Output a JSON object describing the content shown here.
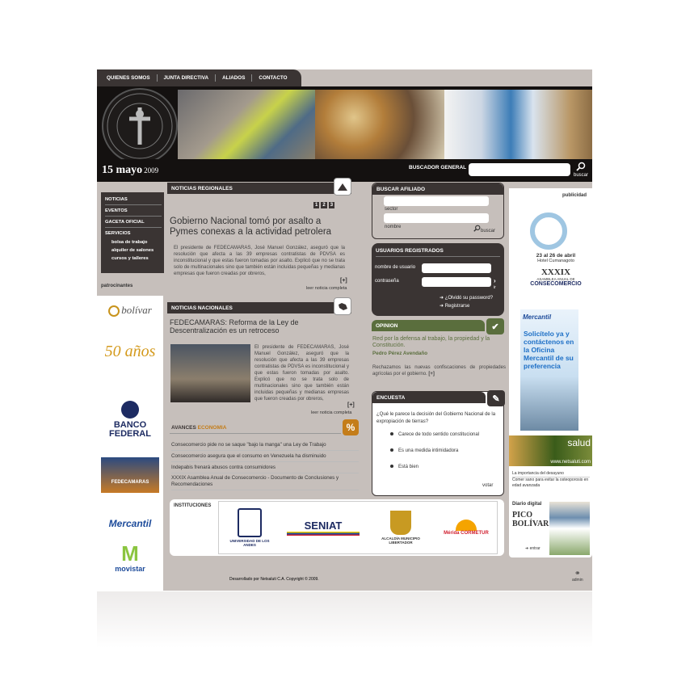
{
  "topnav": [
    "QUIENES SOMOS",
    "JUNTA DIRECTIVA",
    "ALIADOS",
    "CONTACTO"
  ],
  "header": {
    "date_day": "15 mayo",
    "date_year": "2009",
    "search_label": "BUSCADOR GENERAL",
    "search_button": "buscar"
  },
  "leftnav": {
    "items": [
      "NOTICIAS",
      "EVENTOS",
      "GACETA OFICIAL",
      "SERVICIOS"
    ],
    "sub": [
      "bolsa de trabajo",
      "alquiler de salones",
      "cursos y talleres"
    ]
  },
  "sponsors": {
    "title": "patrocinantes",
    "items": [
      "bolívar",
      "50 años",
      "BANCO FEDERAL",
      "FEDECAMARAS",
      "Mercantil",
      "movistar"
    ]
  },
  "regional": {
    "title": "NOTICIAS REGIONALES",
    "pages": [
      "1",
      "2",
      "3"
    ],
    "headline": "Gobierno Nacional tomó por asalto a Pymes conexas a la actividad petrolera",
    "body": "El presidente de FEDECAMARAS, José Manuel González, aseguró que la resolución que afecta a las 39 empresas contratistas de PDVSA es inconstitucional y que estas fueron tomadas por asalto. Explicó que no se trata solo de multinacionales sino que también están incluidas pequeñas y medianas empresas que fueron creadas por obreros,",
    "more": "[+]",
    "more_label": "leer noticia completa"
  },
  "national": {
    "title": "NOTICIAS NACIONALES",
    "headline": "FEDECAMARAS: Reforma de la Ley de Descentralización es un retroceso",
    "body": "El presidente de FEDECAMARAS, José Manuel González, aseguró que la resolución que afecta a las 39 empresas contratistas de PDVSA es inconstitucional y que estas fueron tomadas por asalto. Explicó que no se trata solo de multinacionales sino que también están incluidas pequeñas y medianas empresas que fueron creadas por obreros,",
    "more": "[+]",
    "more_label": "leer noticia completa"
  },
  "avances": {
    "title": "AVANCES",
    "title_accent": "ECONOMIA",
    "icon": "%",
    "items": [
      "Consecomercio pide no se saque \"bajo la manga\" una Ley de Trabajo",
      "Consecomercio asegura que el consumo en Venezuela ha disminuido",
      "Indepabis frenará abusos contra consumidores",
      "XXXIX Asamblea Anual de Consecomercio - Documento de Conclusiones y Recomendaciones"
    ]
  },
  "buscar": {
    "title": "BUSCAR AFILIADO",
    "sector": "sector",
    "nombre": "nombre",
    "button": "buscar"
  },
  "usuarios": {
    "title": "USUARIOS REGISTRADOS",
    "user_label": "nombre de usuario",
    "pass_label": "contraseña",
    "go": "ir",
    "forgot": "¿Olvidó su password?",
    "register": "Registrarse"
  },
  "opinion": {
    "title": "OPINION",
    "headline": "Red por la defensa al trabajo, la propiedad y la Constitución.",
    "author": "Pedro Pérez Avendaño",
    "body": "Rechazamos las nuevas confiscaciones de propiedades agrícolas por el gobierno.",
    "more": "[+]"
  },
  "encuesta": {
    "title": "ENCUESTA",
    "question": "¿Qué le parece la decisión del Gobierno Nacional de la expropiación de tierras?",
    "options": [
      "Carece de todo sentido constitucional",
      "Es una medida intimidadora",
      "Está bien"
    ],
    "vote": "votar"
  },
  "publicidad": {
    "title": "publicidad",
    "ad1_date": "23 al 26 de abril",
    "ad1_place": "Hotel Cumanagoto",
    "ad1_num": "XXXIX",
    "ad1_sub": "ASAMBLEA ANUAL DE",
    "ad1_org": "CONSECOMERCIO",
    "ad2_brand": "Mercantil",
    "ad2_text": "Solicítelo ya y contáctenos en la Oficina Mercantil de su preferencia",
    "ad3_brand": "salud",
    "ad3_url": "www.netsaluti.com",
    "news": [
      "La importancia del desayuno",
      "Comer sano para evitar la osteoporosis en edad avanzada"
    ],
    "diario_label": "Diario digital",
    "diario_name": "PICO BOLÍVAR",
    "diario_btn": "entrar"
  },
  "instituciones": {
    "title": "INSTITUCIONES",
    "items": [
      "UNIVERSIDAD DE LOS ANDES",
      "SENIAT",
      "ALCALDÍA MUNICIPIO LIBERTADOR",
      "Mérida CORMETUR"
    ]
  },
  "footer": {
    "text": "Desarrollado por Netsaluti C.A. Copyright © 2009.",
    "admin": "admin"
  }
}
